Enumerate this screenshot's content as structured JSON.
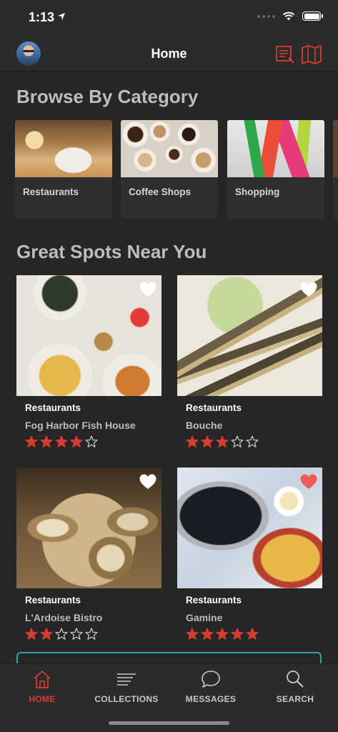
{
  "status_bar": {
    "time": "1:13"
  },
  "nav": {
    "title": "Home"
  },
  "browse": {
    "title": "Browse By Category",
    "categories": [
      {
        "label": "Restaurants"
      },
      {
        "label": "Coffee Shops"
      },
      {
        "label": "Shopping"
      }
    ]
  },
  "spots": {
    "title": "Great Spots Near You",
    "items": [
      {
        "category": "Restaurants",
        "name": "Fog Harbor Fish House",
        "rating": 4,
        "max_rating": 5,
        "favorited": false
      },
      {
        "category": "Restaurants",
        "name": "Bouche",
        "rating": 3,
        "max_rating": 5,
        "favorited": false
      },
      {
        "category": "Restaurants",
        "name": "L'Ardoise Bistro",
        "rating": 2,
        "max_rating": 5,
        "favorited": false
      },
      {
        "category": "Restaurants",
        "name": "Gamine",
        "rating": 5,
        "max_rating": 5,
        "favorited": true
      }
    ]
  },
  "tabs": [
    {
      "label": "HOME",
      "icon": "home-icon",
      "active": true
    },
    {
      "label": "COLLECTIONS",
      "icon": "collections-icon",
      "active": false
    },
    {
      "label": "MESSAGES",
      "icon": "chat-bubble-icon",
      "active": false
    },
    {
      "label": "SEARCH",
      "icon": "search-icon",
      "active": false
    }
  ],
  "colors": {
    "accent": "#d63c30",
    "background": "#262626",
    "bar": "#2b2b2b",
    "promo_border": "#2aa3b3"
  }
}
